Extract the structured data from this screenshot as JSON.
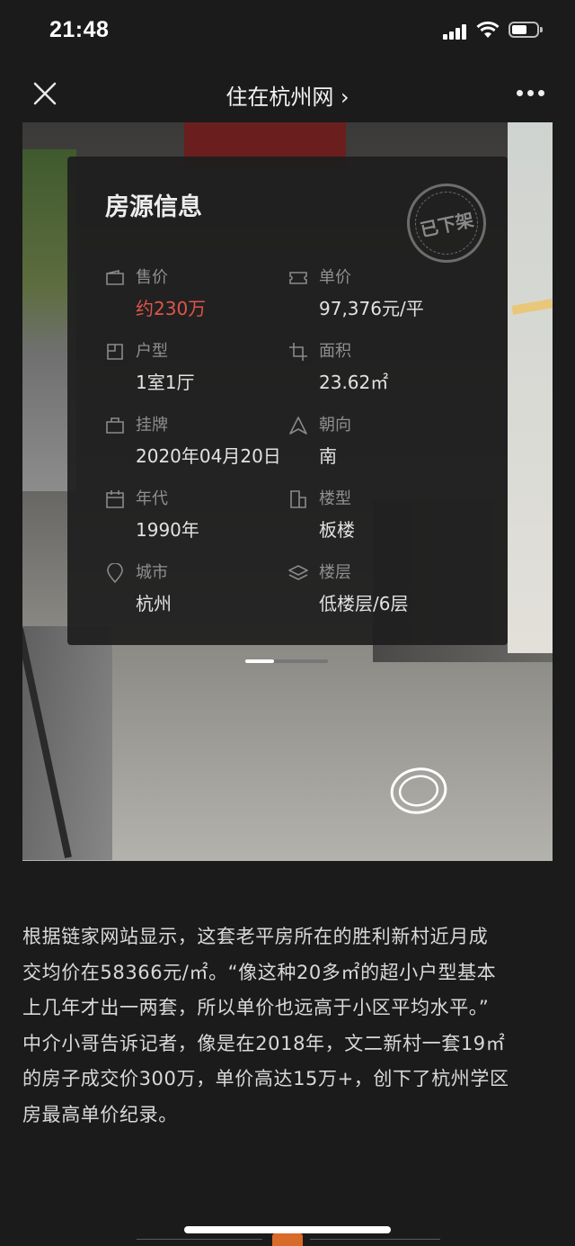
{
  "status_bar": {
    "time": "21:48"
  },
  "nav": {
    "title": "住在杭州网 ›"
  },
  "card": {
    "title": "房源信息",
    "stamp": "已下架",
    "fields": [
      {
        "label": "售价",
        "value": "约230万",
        "icon": "wallet-icon"
      },
      {
        "label": "单价",
        "value": "97,376元/平",
        "icon": "ticket-icon"
      },
      {
        "label": "户型",
        "value": "1室1厅",
        "icon": "floorplan-icon"
      },
      {
        "label": "面积",
        "value": "23.62㎡",
        "icon": "crop-icon"
      },
      {
        "label": "挂牌",
        "value": "2020年04月20日",
        "icon": "tag-icon"
      },
      {
        "label": "朝向",
        "value": "南",
        "icon": "compass-icon"
      },
      {
        "label": "年代",
        "value": "1990年",
        "icon": "calendar-icon"
      },
      {
        "label": "楼型",
        "value": "板楼",
        "icon": "building-icon"
      },
      {
        "label": "城市",
        "value": "杭州",
        "icon": "location-pin-icon"
      },
      {
        "label": "楼层",
        "value": "低楼层/6层",
        "icon": "layers-icon"
      }
    ],
    "accent_price_color": "#e0554a"
  },
  "pager": {
    "current": 1,
    "total": 3
  },
  "article": {
    "lines": [
      "根据链家网站显示，这套老平房所在的胜利新村近月成",
      "交均价在58366元/㎡。“像这种20多㎡的超小户型基本",
      "上几年才出一两套，所以单价也远高于小区平均水平。”",
      "中介小哥告诉记者，像是在2018年，文二新村一套19㎡",
      "的房子成交价300万，单价高达15万+，创下了杭州学区",
      "房最高单价纪录。"
    ]
  }
}
